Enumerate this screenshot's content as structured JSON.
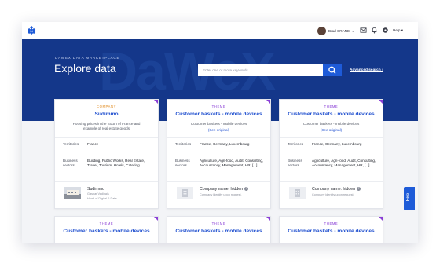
{
  "header": {
    "user_name": "Brad CRANE",
    "user_caret": "▾",
    "help_label": "Help ▾",
    "icons": [
      "logo-icon",
      "mail-icon",
      "bell-icon",
      "settings-icon"
    ]
  },
  "hero": {
    "watermark": "DaWeX",
    "eyebrow": "DAWEX DATA MARKETPLACE",
    "title": "Explore data",
    "search_placeholder": "Enter one or more keywords",
    "advanced_search": "Advanced search ›",
    "view_modes": [
      "list-view-icon",
      "grid-view-icon"
    ]
  },
  "colors": {
    "hero_bg": "#14378a",
    "accent_blue": "#1e5bd8",
    "company_tag": "#e08a1e",
    "theme_tag": "#8a3fd6"
  },
  "labels": {
    "territories": "Territories",
    "business_sectors": "Business sectors"
  },
  "cards": [
    {
      "tag": "COMPANY",
      "title": "Sudimmo",
      "description": "Housing prices in the South of France and example of real estate goods",
      "link": "",
      "territories": "France",
      "sectors": "Building, Public Works, Real Estate, Travel, Tourism, Hotels, Catering",
      "provider_name": "Sudimmo",
      "provider_person": "Gaspar Vadinais",
      "provider_role": "Head of Digital & Data"
    },
    {
      "tag": "THEME",
      "title": "Customer baskets - mobile devices",
      "description": "Customer baskets - mobile devices",
      "link": "(See original)",
      "territories": "France, Germany, Luxembourg",
      "sectors": "Agriculture, Agri-food, Audit, Consulting, Accountancy, Management, HR, [...]",
      "provider_name": "Company name: hidden",
      "provider_person": "Company identity upon request.",
      "provider_role": ""
    },
    {
      "tag": "THEME",
      "title": "Customer baskets - mobile devices",
      "description": "Customer baskets - mobile devices",
      "link": "(See original)",
      "territories": "France, Germany, Luxembourg",
      "sectors": "Agriculture, Agri-food, Audit, Consulting, Accountancy, Management, HR, [...]",
      "provider_name": "Company name: hidden",
      "provider_person": "Company identity upon request.",
      "provider_role": ""
    },
    {
      "tag": "THEME",
      "title": "Customer baskets - mobile devices"
    },
    {
      "tag": "THEME",
      "title": "Customer baskets - mobile devices"
    },
    {
      "tag": "THEME",
      "title": "Customer baskets - mobile devices"
    }
  ],
  "side_help": "Help"
}
